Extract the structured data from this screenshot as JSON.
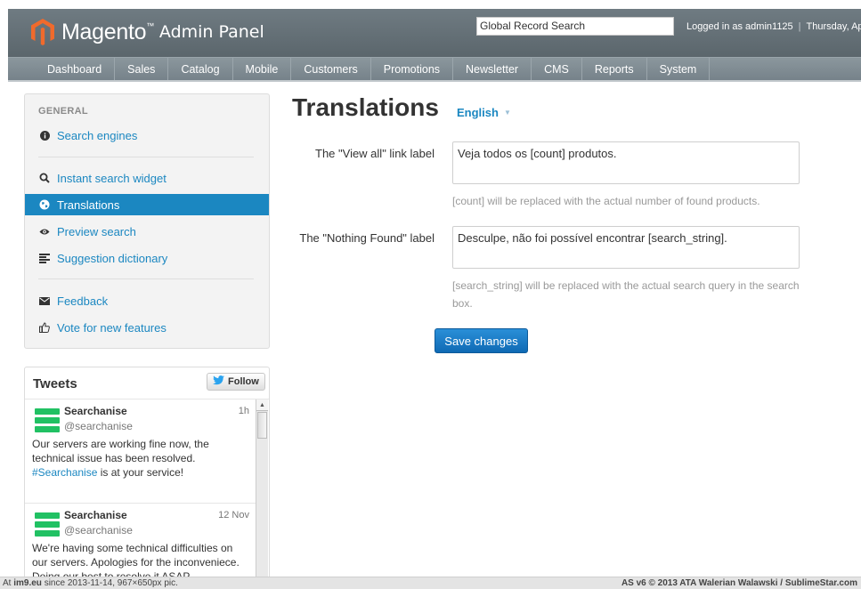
{
  "header": {
    "brand": "Magento",
    "brand_tm": "™",
    "subtitle": "Admin Panel",
    "global_search_value": "Global Record Search",
    "logged_in": "Logged in as admin1125",
    "separator": "|",
    "date_fragment": "Thursday, Ap"
  },
  "nav": {
    "items": [
      "Dashboard",
      "Sales",
      "Catalog",
      "Mobile",
      "Customers",
      "Promotions",
      "Newsletter",
      "CMS",
      "Reports",
      "System"
    ]
  },
  "sidebar": {
    "heading": "GENERAL",
    "items": [
      {
        "label": "Search engines",
        "icon": "info-icon"
      },
      {
        "label": "Instant search widget",
        "icon": "search-icon"
      },
      {
        "label": "Translations",
        "icon": "globe-icon"
      },
      {
        "label": "Preview search",
        "icon": "eye-icon"
      },
      {
        "label": "Suggestion dictionary",
        "icon": "list-icon"
      },
      {
        "label": "Feedback",
        "icon": "envelope-icon"
      },
      {
        "label": "Vote for new features",
        "icon": "thumbs-up-icon"
      }
    ]
  },
  "tweets": {
    "title": "Tweets",
    "follow_label": "Follow",
    "items": [
      {
        "name": "Searchanise",
        "handle": "@searchanise",
        "time": "1h",
        "text_before": "Our servers are working fine now, the technical issue has been resolved. ",
        "hashtag": "#Searchanise",
        "text_after": " is at your service!"
      },
      {
        "name": "Searchanise",
        "handle": "@searchanise",
        "time": "12 Nov",
        "text_before": "We're having some technical difficulties on our servers. Apologies for the inconveniece. Doing our best to resolve it ASAP.",
        "hashtag": "",
        "text_after": ""
      }
    ]
  },
  "main": {
    "title": "Translations",
    "language": "English",
    "fields": [
      {
        "label": "The \"View all\" link label",
        "value": "Veja todos os [count] produtos.",
        "hint": "[count] will be replaced with the actual number of found products."
      },
      {
        "label": "The \"Nothing Found\" label",
        "value": "Desculpe, não foi possível encontrar [search_string].",
        "hint": "[search_string] will be replaced with the actual search query in the search box."
      }
    ],
    "save_label": "Save changes"
  },
  "footer": {
    "left_prefix": "At ",
    "left_site": "im9.eu",
    "left_rest": " since 2013-11-14, 967×650px pic.",
    "right": "AS v6 © 2013 ATA Walerian Walawski / SublimeStar.com"
  },
  "colors": {
    "accent": "#1b87c1",
    "header": "#636e75",
    "brand_orange": "#f06a2c",
    "twitter_green": "#21c163"
  }
}
